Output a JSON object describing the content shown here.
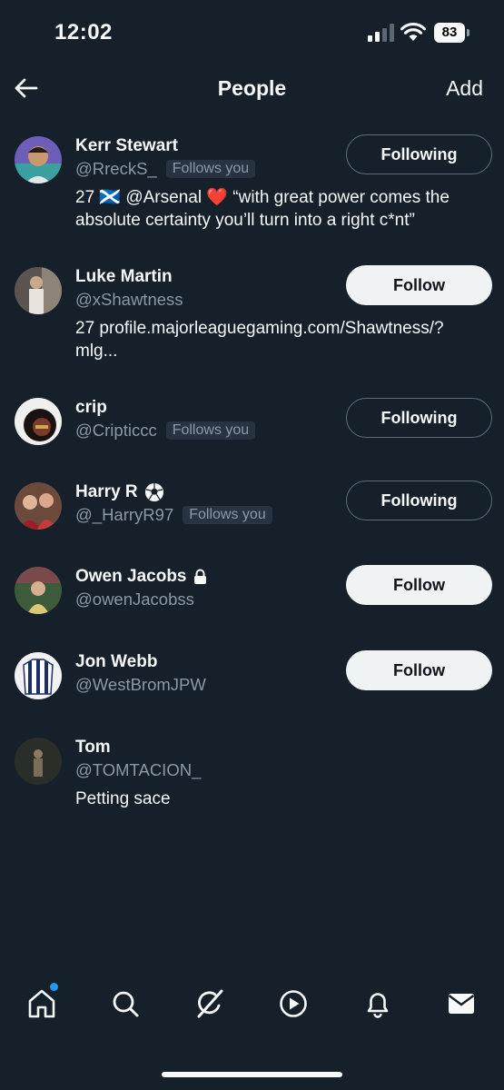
{
  "status_bar": {
    "time": "12:02",
    "battery": "83"
  },
  "header": {
    "title": "People",
    "add_label": "Add"
  },
  "people": [
    {
      "name": "Kerr Stewart",
      "handle": "@RreckS_",
      "follows_you": "Follows you",
      "button": "Following",
      "bio_line1": "27 🏴󠁧󠁢󠁳󠁣󠁴󠁿 @Arsenal ❤️ “with great power comes the",
      "bio_line2": "absolute certainty you’ll turn into a right c*nt”"
    },
    {
      "name": "Luke Martin",
      "handle": "@xShawtness",
      "button": "Follow",
      "bio_line1": "27 profile.majorleaguegaming.com/Shawtness/?",
      "bio_line2": "mlg..."
    },
    {
      "name": "crip",
      "handle": "@Cripticcc",
      "follows_you": "Follows you",
      "button": "Following"
    },
    {
      "name": "Harry R",
      "name_emoji": "soccer-ball",
      "handle": "@_HarryR97",
      "follows_you": "Follows you",
      "button": "Following"
    },
    {
      "name": "Owen Jacobs",
      "name_icon": "lock",
      "handle": "@owenJacobss",
      "button": "Follow"
    },
    {
      "name": "Jon Webb",
      "handle": "@WestBromJPW",
      "button": "Follow"
    },
    {
      "name": "Tom",
      "handle": "@TOMTACION_",
      "bio_line1": "Petting sace"
    }
  ],
  "nav": [
    "home-icon",
    "search-icon",
    "grok-icon",
    "video-icon",
    "notifications-icon",
    "messages-icon"
  ],
  "colors": {
    "background": "#15202b",
    "text": "#f7f9f9",
    "muted": "#8b98a5",
    "accent": "#1d9bf0",
    "follow_bg": "#eff3f4"
  }
}
